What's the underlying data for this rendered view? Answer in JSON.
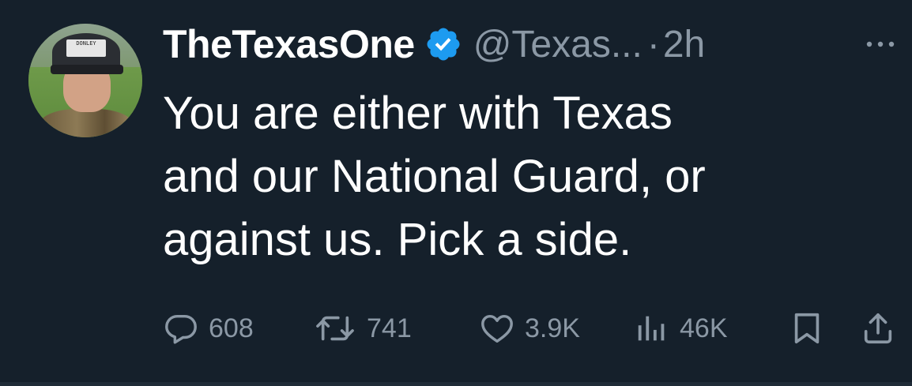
{
  "user": {
    "display_name": "TheTexasOne",
    "handle": "@Texas...",
    "separator": "·",
    "time": "2h",
    "verified": true,
    "avatar_cap_text": "DONLEY"
  },
  "tweet": {
    "lines": [
      "You are either with Texas",
      "and our National Guard, or",
      "against us. Pick a side."
    ]
  },
  "actions": {
    "replies": "608",
    "retweets": "741",
    "likes": "3.9K",
    "views": "46K"
  },
  "colors": {
    "background": "#15202b",
    "text": "#ffffff",
    "secondary": "#8b98a5",
    "verified_badge": "#1d9bf0"
  },
  "icons": {
    "verified": "verified-badge-icon",
    "more": "more-options-icon",
    "reply": "reply-icon",
    "retweet": "retweet-icon",
    "like": "heart-icon",
    "views": "views-icon",
    "bookmark": "bookmark-icon",
    "share": "share-icon"
  }
}
